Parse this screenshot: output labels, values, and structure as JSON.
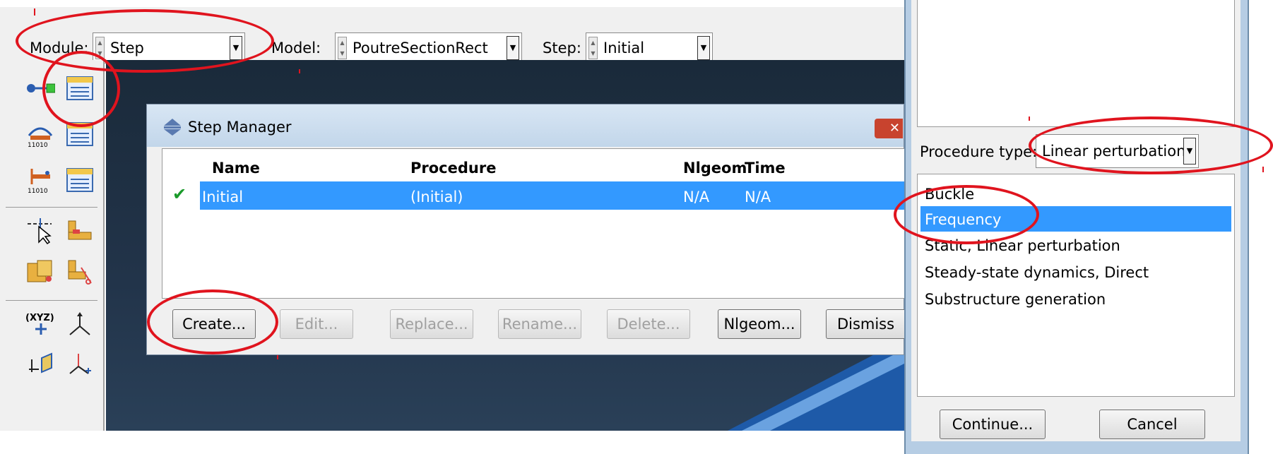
{
  "toolbar": {
    "module_label": "Module:",
    "module_value": "Step",
    "model_label": "Model:",
    "model_value": "PoutreSectionRect",
    "step_label": "Step:",
    "step_value": "Initial"
  },
  "toolbox": {
    "tools": [
      "create-step-icon",
      "step-manager-icon",
      "field-output-icon",
      "field-manager-icon",
      "history-output-icon",
      "history-manager-icon",
      "select-icon",
      "datum-icon",
      "partition-icon",
      "cut-icon",
      "datum-point-icon",
      "datum-axis-icon",
      "datum-plane-icon",
      "datum-csys-icon"
    ]
  },
  "step_manager": {
    "title": "Step Manager",
    "columns": [
      "Name",
      "Procedure",
      "Nlgeom",
      "Time"
    ],
    "rows": [
      {
        "name": "Initial",
        "procedure": "(Initial)",
        "nlgeom": "N/A",
        "time": "N/A",
        "checked": true
      }
    ],
    "buttons": {
      "create": "Create...",
      "edit": "Edit...",
      "replace": "Replace...",
      "rename": "Rename...",
      "delete": "Delete...",
      "nlgeom": "Nlgeom...",
      "dismiss": "Dismiss"
    }
  },
  "create_step": {
    "procedure_type_label": "Procedure type:",
    "procedure_type_value": "Linear perturbation",
    "procedures": [
      "Buckle",
      "Frequency",
      "Static, Linear perturbation",
      "Steady-state dynamics, Direct",
      "Substructure generation"
    ],
    "selected_procedure": "Frequency",
    "continue_label": "Continue...",
    "cancel_label": "Cancel"
  },
  "colors": {
    "selection": "#3399ff",
    "annotation": "#e0141e",
    "viewport": "#1f3246"
  }
}
